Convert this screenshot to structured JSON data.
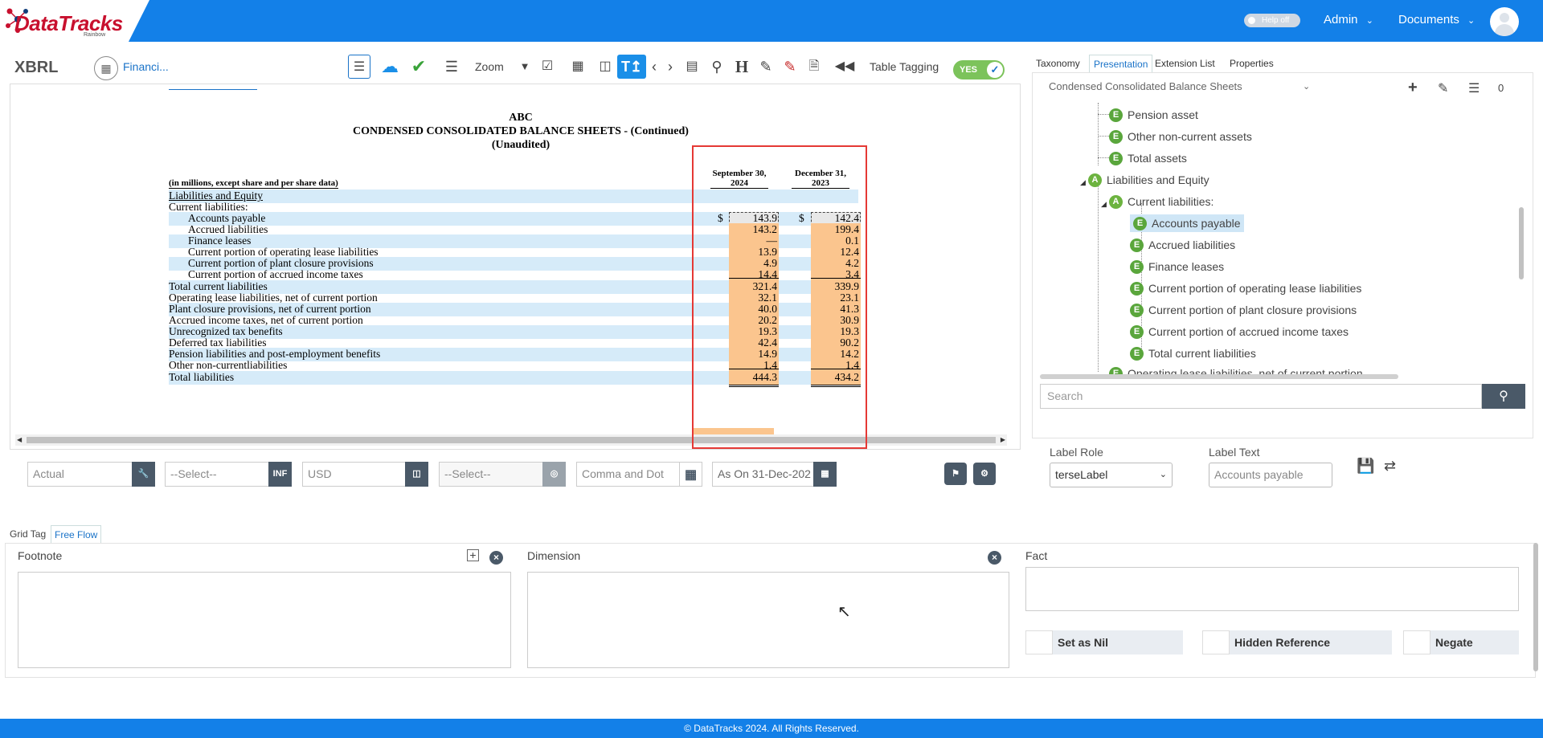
{
  "header": {
    "logo_text": "DataTracks",
    "logo_sub": "Rainbow",
    "help_toggle": "Help off",
    "admin_menu": "Admin",
    "documents_menu": "Documents"
  },
  "toolbar": {
    "xbrl_label": "XBRL",
    "doc_selector": "Financi...",
    "zoom_label": "Zoom",
    "table_tagging_label": "Table Tagging",
    "table_tagging_value": "YES"
  },
  "document": {
    "company": "ABC",
    "title": "CONDENSED CONSOLIDATED BALANCE SHEETS - (Continued)",
    "subtitle": "(Unaudited)",
    "units_note": "(in millions, except share and per share data)",
    "col1_header": [
      "September 30,",
      "2024"
    ],
    "col2_header": [
      "December 31,",
      "2023"
    ],
    "rows": [
      {
        "label": "Liabilities and Equity",
        "c1": "",
        "c2": ""
      },
      {
        "label": "Current liabilities:",
        "c1": "",
        "c2": ""
      },
      {
        "label": "Accounts payable",
        "c1": "143.9",
        "c2": "142.4"
      },
      {
        "label": "Accrued liabilities",
        "c1": "143.2",
        "c2": "199.4"
      },
      {
        "label": "Finance leases",
        "c1": "—",
        "c2": "0.1"
      },
      {
        "label": "Current portion of operating lease liabilities",
        "c1": "13.9",
        "c2": "12.4"
      },
      {
        "label": "Current portion of plant closure provisions",
        "c1": "4.9",
        "c2": "4.2"
      },
      {
        "label": "Current portion of accrued income taxes",
        "c1": "14.4",
        "c2": "3.4"
      },
      {
        "label": "Total current liabilities",
        "c1": "321.4",
        "c2": "339.9"
      },
      {
        "label": "Operating lease liabilities, net of current portion",
        "c1": "32.1",
        "c2": "23.1"
      },
      {
        "label": "Plant closure provisions, net of current portion",
        "c1": "40.0",
        "c2": "41.3"
      },
      {
        "label": "Accrued income taxes, net of current portion",
        "c1": "20.2",
        "c2": "30.9"
      },
      {
        "label": "Unrecognized tax benefits",
        "c1": "19.3",
        "c2": "19.3"
      },
      {
        "label": "Deferred tax liabilities",
        "c1": "42.4",
        "c2": "90.2"
      },
      {
        "label": "Pension liabilities and post-employment benefits",
        "c1": "14.9",
        "c2": "14.2"
      },
      {
        "label": "Other non-currentliabilities",
        "c1": "1.4",
        "c2": "1.4"
      },
      {
        "label": "Total liabilities",
        "c1": "444.3",
        "c2": "434.2"
      }
    ],
    "dollar_sign": "$"
  },
  "fields": {
    "actual": "Actual",
    "select1": "--Select--",
    "inf_btn": "INF",
    "currency": "USD",
    "select2": "--Select--",
    "separator": "Comma and Dot",
    "date": "As On 31-Dec-202"
  },
  "right_panel": {
    "tabs": [
      "Taxonomy",
      "Presentation",
      "Extension List",
      "Properties"
    ],
    "active_tab": "Presentation",
    "presentation_select": "Condensed Consolidated Balance Sheets",
    "count": "0",
    "tree": [
      {
        "badge": "E",
        "label": "Pension asset"
      },
      {
        "badge": "E",
        "label": "Other non-current assets"
      },
      {
        "badge": "E",
        "label": "Total assets"
      },
      {
        "badge": "A",
        "label": "Liabilities and Equity"
      },
      {
        "badge": "A",
        "label": "Current liabilities:"
      },
      {
        "badge": "E",
        "label": "Accounts payable"
      },
      {
        "badge": "E",
        "label": "Accrued liabilities"
      },
      {
        "badge": "E",
        "label": "Finance leases"
      },
      {
        "badge": "E",
        "label": "Current portion of operating lease liabilities"
      },
      {
        "badge": "E",
        "label": "Current portion of plant closure provisions"
      },
      {
        "badge": "E",
        "label": "Current portion of accrued income taxes"
      },
      {
        "badge": "E",
        "label": "Total current liabilities"
      },
      {
        "badge": "E",
        "label": "Operating lease liabilities, net of current portion"
      }
    ],
    "search_placeholder": "Search",
    "label_role_label": "Label Role",
    "label_role_value": "terseLabel",
    "label_text_label": "Label Text",
    "label_text_value": "Accounts payable"
  },
  "bottom": {
    "tabs": [
      "Grid Tag",
      "Free Flow"
    ],
    "active_tab": "Free Flow",
    "footnote_label": "Footnote",
    "dimension_label": "Dimension",
    "fact_label": "Fact",
    "set_nil": "Set as Nil",
    "hidden_ref": "Hidden Reference",
    "negate": "Negate"
  },
  "footer": {
    "text": "© DataTracks 2024. All Rights Reserved."
  },
  "colors": {
    "brand_blue": "#1380e8",
    "tag_orange": "#fbc58e",
    "row_blue": "#d6ebf9",
    "red_box": "#e53935"
  }
}
